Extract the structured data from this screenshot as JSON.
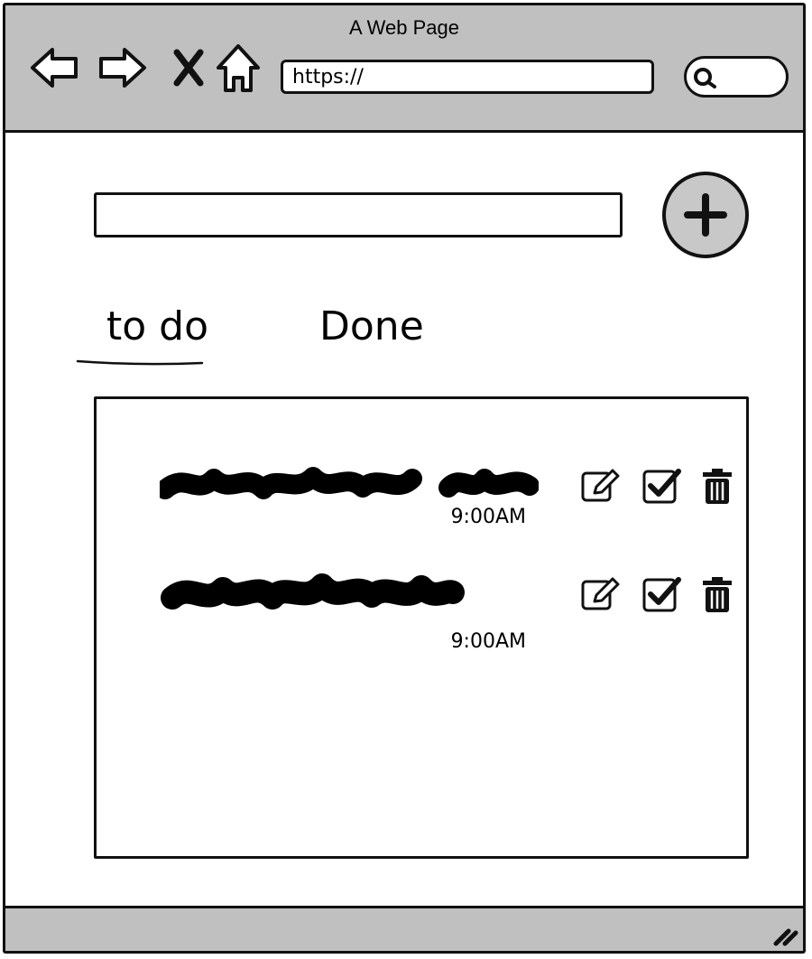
{
  "window": {
    "title": "A Web Page"
  },
  "toolbar": {
    "back_icon": "arrow-left-icon",
    "forward_icon": "arrow-right-icon",
    "stop_icon": "close-icon",
    "home_icon": "home-icon",
    "search_icon": "search-icon"
  },
  "address_bar": {
    "url": "https://"
  },
  "task_input": {
    "value": "",
    "placeholder": ""
  },
  "add_button": {
    "icon": "plus-icon",
    "accent": "#c8c8c8"
  },
  "tabs": [
    {
      "label": "to do",
      "active": true
    },
    {
      "label": "Done",
      "active": false
    }
  ],
  "items": [
    {
      "time": "9:00AM"
    },
    {
      "time": "9:00AM"
    }
  ],
  "item_actions": {
    "edit_icon": "edit-icon",
    "complete_icon": "checkbox-icon",
    "delete_icon": "trash-icon"
  },
  "colors": {
    "chrome": "#c0c0c0",
    "outline": "#111111"
  }
}
